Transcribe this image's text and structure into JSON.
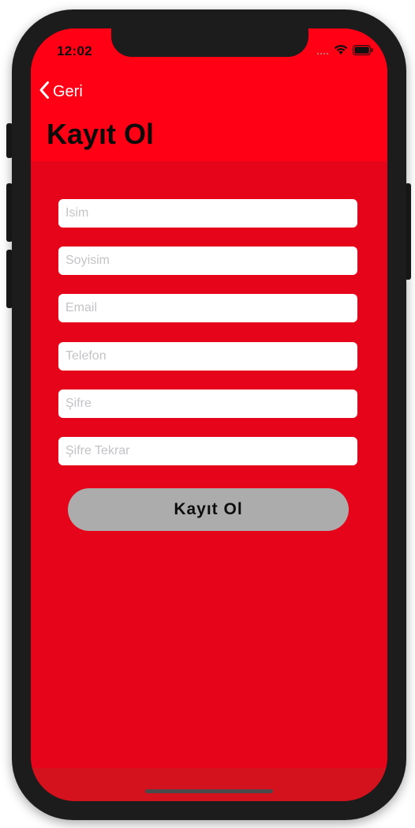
{
  "status_bar": {
    "time": "12:02",
    "icons": [
      "cellular-icon",
      "wifi-icon",
      "battery-icon"
    ]
  },
  "nav": {
    "back_label": "Geri",
    "back_icon": "chevron-left-icon",
    "title": "Kayıt Ol"
  },
  "form": {
    "fields": [
      {
        "placeholder": "İsim",
        "value": ""
      },
      {
        "placeholder": "Soyisim",
        "value": ""
      },
      {
        "placeholder": "Email",
        "value": ""
      },
      {
        "placeholder": "Telefon",
        "value": ""
      },
      {
        "placeholder": "Şifre",
        "value": ""
      },
      {
        "placeholder": "Şifre Tekrar",
        "value": ""
      }
    ],
    "submit_label": "Kayıt Ol"
  },
  "colors": {
    "header_bg": "#ff0014",
    "content_bg": "#e50419",
    "button_bg": "#acacac",
    "input_bg": "#ffffff"
  }
}
